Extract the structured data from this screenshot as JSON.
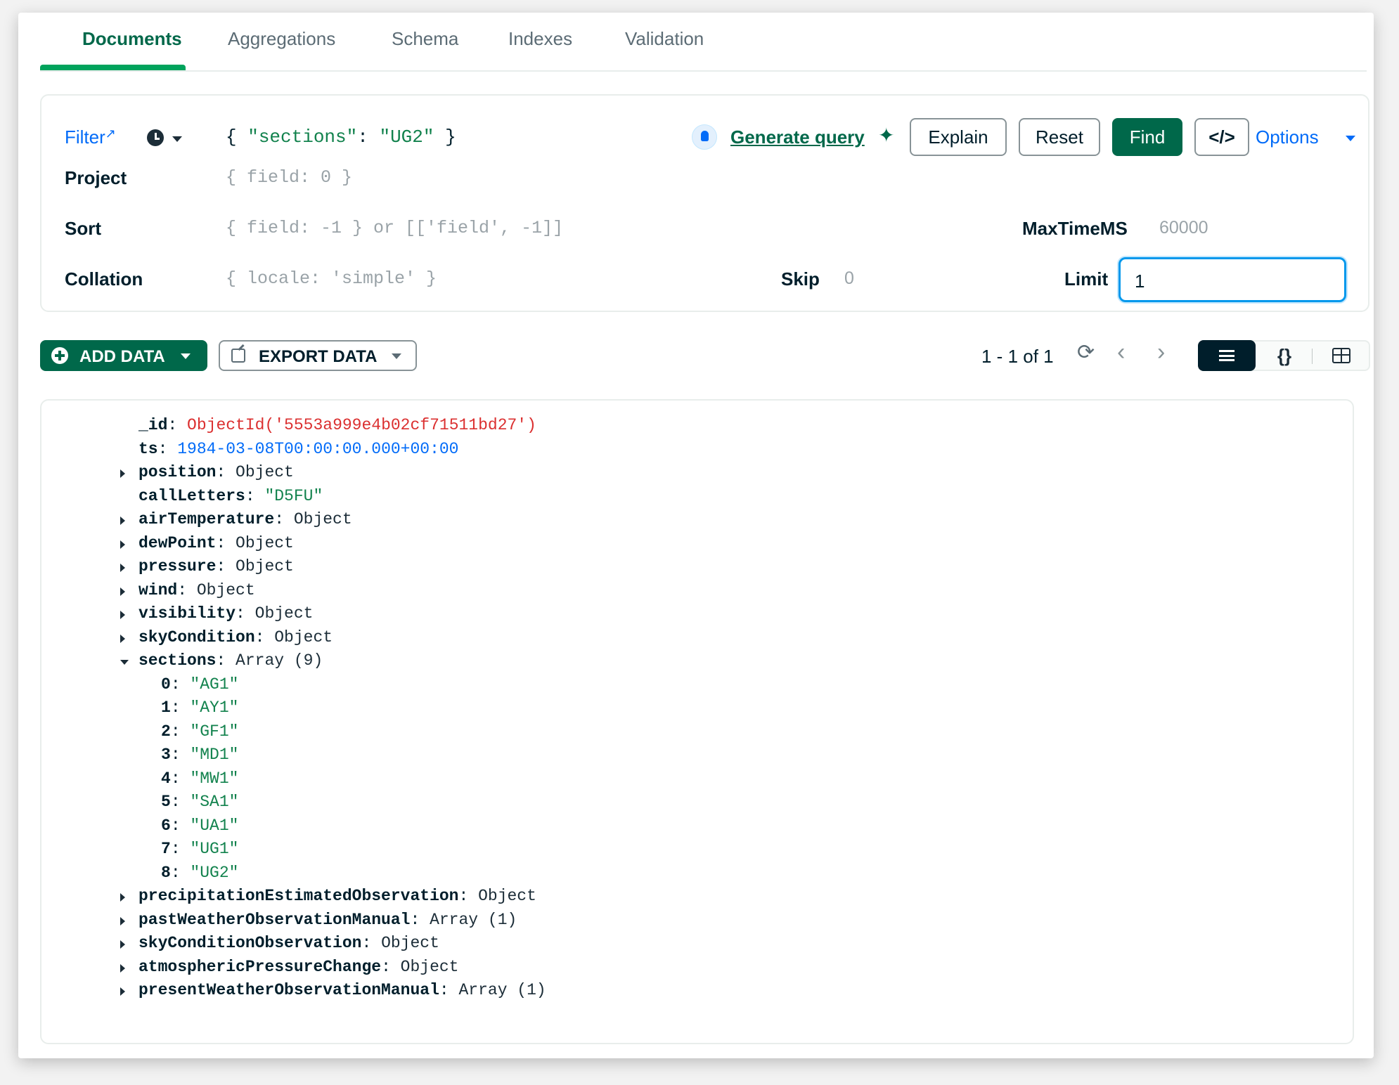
{
  "tabs": [
    {
      "label": "Documents",
      "active": true
    },
    {
      "label": "Aggregations",
      "active": false
    },
    {
      "label": "Schema",
      "active": false
    },
    {
      "label": "Indexes",
      "active": false
    },
    {
      "label": "Validation",
      "active": false
    }
  ],
  "query": {
    "filter_label": "Filter",
    "filter_value_open": "{ ",
    "filter_value_key": "\"sections\"",
    "filter_value_colon": ": ",
    "filter_value_val": "\"UG2\"",
    "filter_value_close": " }",
    "generate_query_label": "Generate query",
    "explain_label": "Explain",
    "reset_label": "Reset",
    "find_label": "Find",
    "code_label": "</>",
    "options_label": "Options",
    "project_label": "Project",
    "project_placeholder": "{ field: 0 }",
    "sort_label": "Sort",
    "sort_placeholder": "{ field: -1 } or [['field', -1]]",
    "maxtime_label": "MaxTimeMS",
    "maxtime_placeholder": "60000",
    "collation_label": "Collation",
    "collation_placeholder": "{ locale: 'simple' }",
    "skip_label": "Skip",
    "skip_placeholder": "0",
    "limit_label": "Limit",
    "limit_value": "1"
  },
  "toolbar": {
    "add_data_label": "ADD DATA",
    "export_data_label": "EXPORT DATA",
    "pagination_text": "1 - 1 of 1",
    "refresh_icon": "⟳",
    "prev_icon": "‹",
    "next_icon": "›",
    "json_view_icon": "{}"
  },
  "document": {
    "lines": [
      {
        "indent": 0,
        "expander": "none",
        "key": "_id",
        "value": "ObjectId('5553a999e4b02cf71511bd27')",
        "kind": "oid"
      },
      {
        "indent": 0,
        "expander": "none",
        "key": "ts",
        "value": "1984-03-08T00:00:00.000+00:00",
        "kind": "date"
      },
      {
        "indent": 0,
        "expander": "collapsed",
        "key": "position",
        "value": "Object",
        "kind": "typ"
      },
      {
        "indent": 0,
        "expander": "none",
        "key": "callLetters",
        "value": "\"D5FU\"",
        "kind": "str"
      },
      {
        "indent": 0,
        "expander": "collapsed",
        "key": "airTemperature",
        "value": "Object",
        "kind": "typ"
      },
      {
        "indent": 0,
        "expander": "collapsed",
        "key": "dewPoint",
        "value": "Object",
        "kind": "typ"
      },
      {
        "indent": 0,
        "expander": "collapsed",
        "key": "pressure",
        "value": "Object",
        "kind": "typ"
      },
      {
        "indent": 0,
        "expander": "collapsed",
        "key": "wind",
        "value": "Object",
        "kind": "typ"
      },
      {
        "indent": 0,
        "expander": "collapsed",
        "key": "visibility",
        "value": "Object",
        "kind": "typ"
      },
      {
        "indent": 0,
        "expander": "collapsed",
        "key": "skyCondition",
        "value": "Object",
        "kind": "typ"
      },
      {
        "indent": 0,
        "expander": "expanded",
        "key": "sections",
        "value": "Array (9)",
        "kind": "typ"
      },
      {
        "indent": 1,
        "expander": "none",
        "key": "0",
        "value": "\"AG1\"",
        "kind": "str"
      },
      {
        "indent": 1,
        "expander": "none",
        "key": "1",
        "value": "\"AY1\"",
        "kind": "str"
      },
      {
        "indent": 1,
        "expander": "none",
        "key": "2",
        "value": "\"GF1\"",
        "kind": "str"
      },
      {
        "indent": 1,
        "expander": "none",
        "key": "3",
        "value": "\"MD1\"",
        "kind": "str"
      },
      {
        "indent": 1,
        "expander": "none",
        "key": "4",
        "value": "\"MW1\"",
        "kind": "str"
      },
      {
        "indent": 1,
        "expander": "none",
        "key": "5",
        "value": "\"SA1\"",
        "kind": "str"
      },
      {
        "indent": 1,
        "expander": "none",
        "key": "6",
        "value": "\"UA1\"",
        "kind": "str"
      },
      {
        "indent": 1,
        "expander": "none",
        "key": "7",
        "value": "\"UG1\"",
        "kind": "str"
      },
      {
        "indent": 1,
        "expander": "none",
        "key": "8",
        "value": "\"UG2\"",
        "kind": "str"
      },
      {
        "indent": 0,
        "expander": "collapsed",
        "key": "precipitationEstimatedObservation",
        "value": "Object",
        "kind": "typ"
      },
      {
        "indent": 0,
        "expander": "collapsed",
        "key": "pastWeatherObservationManual",
        "value": "Array (1)",
        "kind": "typ"
      },
      {
        "indent": 0,
        "expander": "collapsed",
        "key": "skyConditionObservation",
        "value": "Object",
        "kind": "typ"
      },
      {
        "indent": 0,
        "expander": "collapsed",
        "key": "atmosphericPressureChange",
        "value": "Object",
        "kind": "typ"
      },
      {
        "indent": 0,
        "expander": "collapsed",
        "key": "presentWeatherObservationManual",
        "value": "Array (1)",
        "kind": "typ"
      }
    ]
  },
  "colors": {
    "brand_green": "#00684a",
    "accent_green": "#00a35c",
    "link_blue": "#016bf8",
    "oid_red": "#db3030",
    "string_green": "#12824d"
  }
}
